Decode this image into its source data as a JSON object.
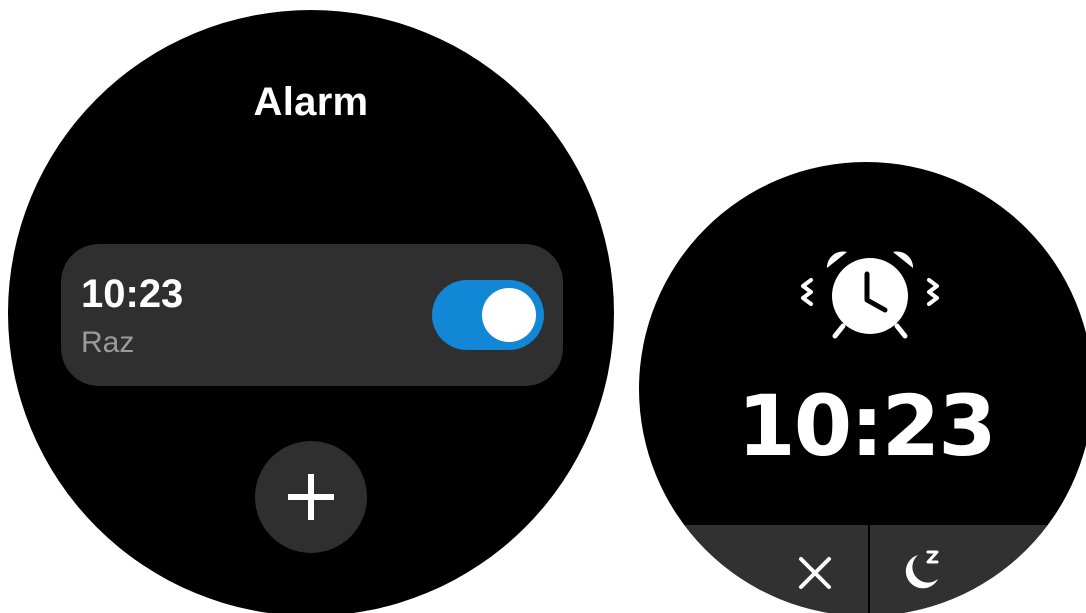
{
  "alarm_list": {
    "title": "Alarm",
    "alarms": [
      {
        "time": "10:23",
        "label": "Raz",
        "enabled": true
      }
    ],
    "add_button_icon": "plus-icon"
  },
  "ringing_alarm": {
    "icon": "alarm-clock-ringing-icon",
    "time": "10:23",
    "dismiss_icon": "close-icon",
    "snooze_icon": "snooze-moon-icon"
  },
  "colors": {
    "watch_background": "#000000",
    "card_background": "#2f2f2f",
    "toggle_on": "#1287d6",
    "secondary_text": "#9a9a9a"
  }
}
